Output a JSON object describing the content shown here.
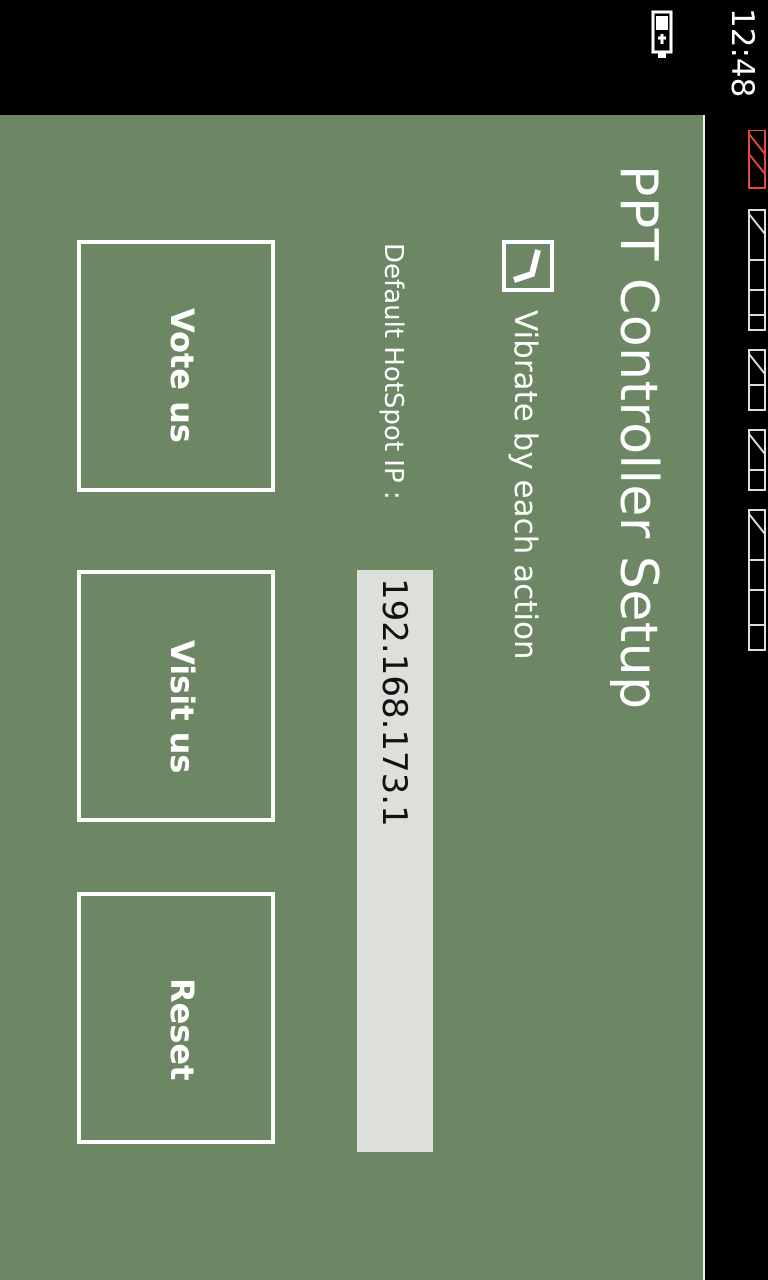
{
  "status_bar": {
    "time": "12:48",
    "battery_icon": "battery-charging-icon"
  },
  "app": {
    "title": "PPT Controller Setup",
    "vibrate": {
      "label": "Vibrate by each action",
      "checked": true
    },
    "hotspot": {
      "label": "Default HotSpot IP :",
      "value": "192.168.173.1"
    },
    "buttons": {
      "vote": "Vote us",
      "visit": "Visit us",
      "reset": "Reset"
    }
  },
  "colors": {
    "background": "#6d8765",
    "input_bg": "#dcdfda",
    "text": "#ffffff",
    "bar": "#000000"
  }
}
